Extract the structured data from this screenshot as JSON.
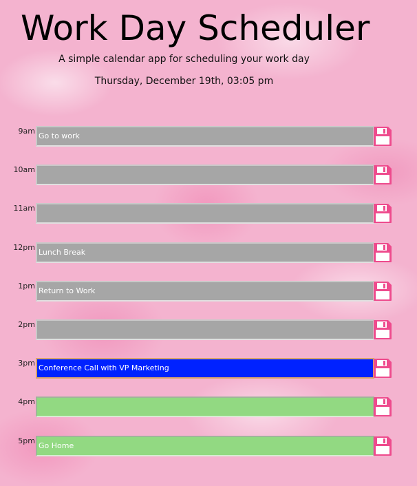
{
  "header": {
    "title": "Work Day Scheduler",
    "subtitle": "A simple calendar app for scheduling your work day",
    "current_date": "Thursday, December 19th, 03:05 pm"
  },
  "colors": {
    "past": "#a6a6a6",
    "present": "#0022ff",
    "future": "#92d982",
    "save_icon": "#ee4b8d"
  },
  "rows": [
    {
      "hour": "9am",
      "text": "Go to work",
      "state": "past"
    },
    {
      "hour": "10am",
      "text": "",
      "state": "past"
    },
    {
      "hour": "11am",
      "text": "",
      "state": "past"
    },
    {
      "hour": "12pm",
      "text": "Lunch Break",
      "state": "past"
    },
    {
      "hour": "1pm",
      "text": "Return to Work",
      "state": "past"
    },
    {
      "hour": "2pm",
      "text": "",
      "state": "past"
    },
    {
      "hour": "3pm",
      "text": "Conference Call with VP Marketing",
      "state": "present"
    },
    {
      "hour": "4pm",
      "text": "",
      "state": "future"
    },
    {
      "hour": "5pm",
      "text": "Go Home",
      "state": "future"
    }
  ],
  "save_icon": "floppy-disk-icon"
}
